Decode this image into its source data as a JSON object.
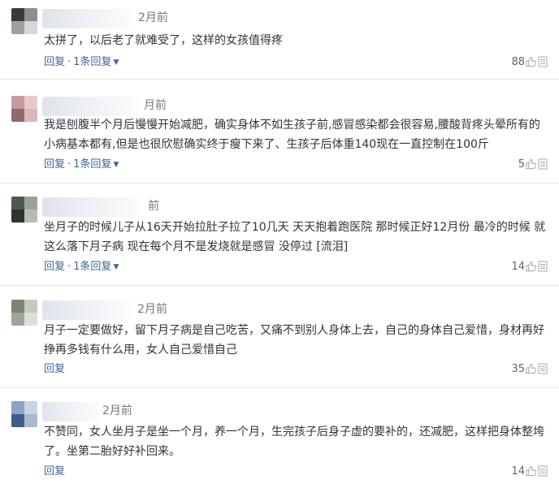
{
  "comments": [
    {
      "time": "2月前",
      "content": "太拼了，以后老了就难受了，这样的女孩值得疼",
      "reply_label": "回复",
      "sep": "·",
      "replies_label": "1条回复",
      "likes": "88"
    },
    {
      "time": "月前",
      "content": "我是刨腹半个月后慢慢开始减肥，确实身体不如生孩子前,感冒感染都会很容易,腰酸背疼头晕所有的小病基本都有,但是也很欣慰确实终于瘦下来了、生孩子后体重140现在一直控制在100斤",
      "reply_label": "回复",
      "sep": "·",
      "replies_label": "1条回复",
      "likes": "5"
    },
    {
      "time": "前",
      "content": "坐月子的时候儿子从16天开始拉肚子拉了10几天 天天抱着跑医院 那时候正好12月份 最冷的时候 就这么落下月子病 现在每个月不是发烧就是感冒 没停过 [流泪]",
      "reply_label": "回复",
      "sep": "·",
      "replies_label": "1条回复",
      "likes": "14"
    },
    {
      "time": "2月前",
      "content": "月子一定要做好，留下月子病是自己吃苦，又痛不到别人身体上去，自己的身体自己爱惜，身材再好挣再多钱有什么用，女人自己爱惜自己",
      "reply_label": "回复",
      "likes": "35"
    },
    {
      "time": "2月前",
      "content": "不赞同，女人坐月子是坐一个月，养一个月，生完孩子后身子虚的要补的，还减肥，这样把身体整垮了。坐第二胎好好补回来。",
      "reply_label": "回复",
      "likes": "14"
    }
  ]
}
